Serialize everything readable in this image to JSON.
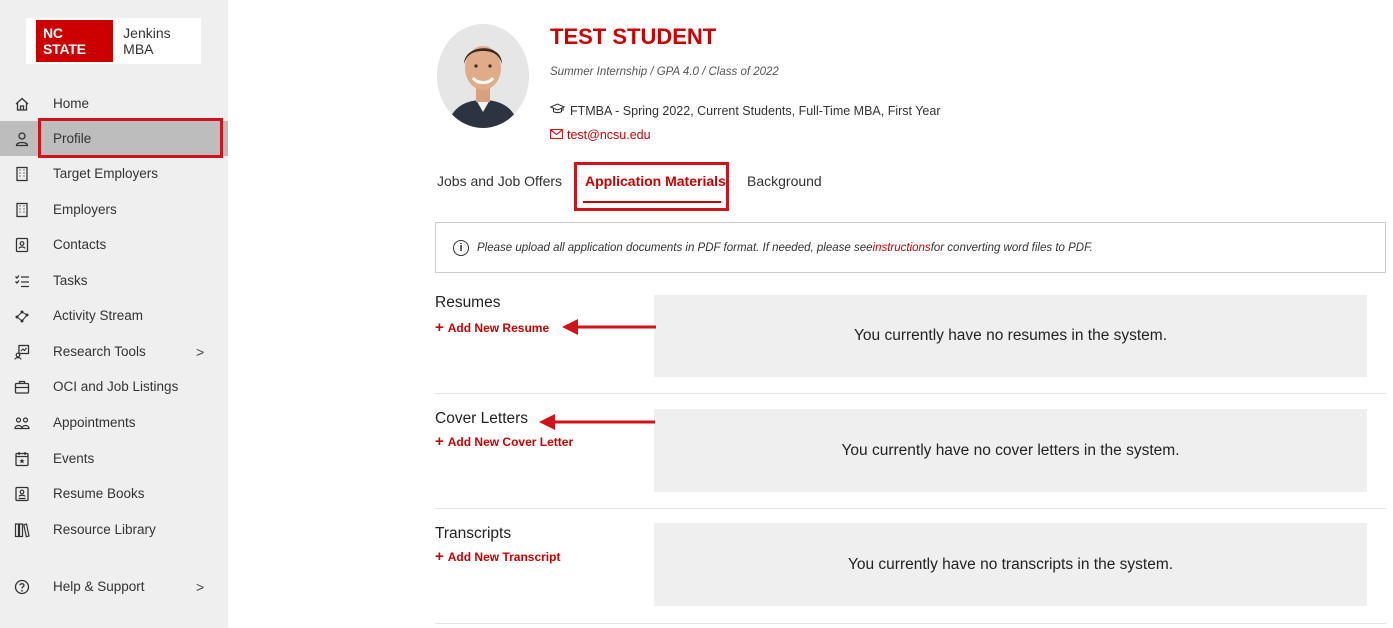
{
  "logo": {
    "brand": "NC STATE",
    "unit": "Jenkins MBA"
  },
  "sidebar": {
    "items": [
      {
        "label": "Home",
        "icon": "home-icon"
      },
      {
        "label": "Profile",
        "icon": "user-icon"
      },
      {
        "label": "Target Employers",
        "icon": "building-icon"
      },
      {
        "label": "Employers",
        "icon": "building-icon"
      },
      {
        "label": "Contacts",
        "icon": "contact-card-icon"
      },
      {
        "label": "Tasks",
        "icon": "checklist-icon"
      },
      {
        "label": "Activity Stream",
        "icon": "network-icon"
      },
      {
        "label": "Research Tools",
        "icon": "research-icon",
        "chevron": ">"
      },
      {
        "label": "OCI and Job Listings",
        "icon": "briefcase-icon"
      },
      {
        "label": "Appointments",
        "icon": "people-icon"
      },
      {
        "label": "Events",
        "icon": "calendar-star-icon"
      },
      {
        "label": "Resume Books",
        "icon": "resume-book-icon"
      },
      {
        "label": "Resource Library",
        "icon": "library-icon"
      },
      {
        "label": "Help & Support",
        "icon": "help-icon",
        "chevron": ">"
      }
    ]
  },
  "profile": {
    "name": "TEST STUDENT",
    "subline": "Summer Internship / GPA 4.0 / Class of 2022",
    "program": "FTMBA - Spring 2022, Current Students, Full-Time MBA, First Year",
    "email": "test@ncsu.edu"
  },
  "tabs": [
    {
      "label": "Jobs and Job Offers"
    },
    {
      "label": "Application Materials"
    },
    {
      "label": "Background"
    }
  ],
  "notice": {
    "before": "Please upload all application documents in PDF format. If needed, please see ",
    "link": "instructions",
    "after": " for converting word files to PDF."
  },
  "sections": [
    {
      "title": "Resumes",
      "add": "Add New Resume",
      "empty": "You currently have no resumes in the system."
    },
    {
      "title": "Cover Letters",
      "add": "Add New Cover Letter",
      "empty": "You currently have no cover letters in the system."
    },
    {
      "title": "Transcripts",
      "add": "Add New Transcript",
      "empty": "You currently have no transcripts in the system."
    }
  ],
  "colors": {
    "accent": "#cc0000",
    "highlight": "#d0121b",
    "sidebar_bg": "#efefef",
    "active_bg": "#bdbdbd"
  }
}
